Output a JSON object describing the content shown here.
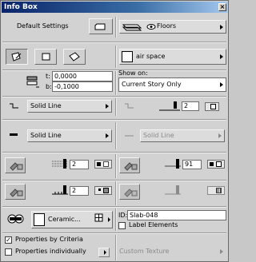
{
  "window": {
    "title": "Info Box",
    "close_glyph": "×"
  },
  "row1": {
    "default_settings_label": "Default Settings",
    "floors_label": "Floors"
  },
  "row2": {
    "layer_value": "air space"
  },
  "row3": {
    "t_label": "t:",
    "t_value": "0,0000",
    "b_label": "b:",
    "b_value": "-0,1000",
    "show_on_label": "Show on:",
    "show_on_value": "Current Story Only"
  },
  "row4": {
    "line_type_left": "Solid Line",
    "pen_value": "2"
  },
  "row5": {
    "line_type_left": "Solid Line",
    "line_type_right": "Solid Line"
  },
  "row6": {
    "pen_left": "2",
    "pen_right": "91"
  },
  "row7": {
    "pen_left": "2"
  },
  "row8": {
    "material_label": "Ceramic...",
    "id_label": "ID:",
    "id_value": "Slab-048",
    "label_elements": "Label Elements",
    "label_elements_checked": false
  },
  "row9": {
    "properties_by_criteria": "Properties by Criteria",
    "properties_by_criteria_checked": true,
    "properties_individually": "Properties individually",
    "properties_individually_checked": false,
    "custom_texture": "Custom Texture",
    "check_mark": "✓"
  }
}
